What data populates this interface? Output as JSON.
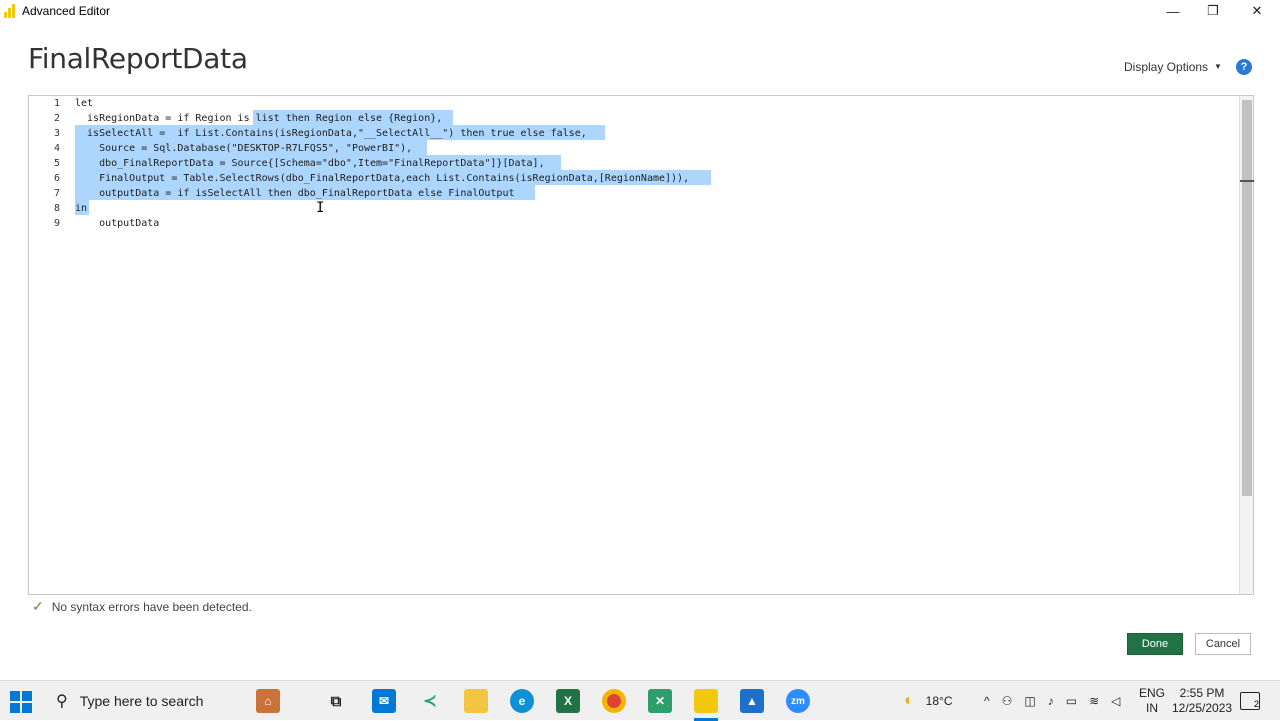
{
  "window": {
    "title": "Advanced Editor",
    "minimize_glyph": "—",
    "restore_glyph": "❐",
    "close_glyph": "✕"
  },
  "editor": {
    "query_name": "FinalReportData",
    "display_options_label": "Display Options",
    "help_glyph": "?",
    "line_numbers": [
      "1",
      "2",
      "3",
      "4",
      "5",
      "6",
      "7",
      "8",
      "9"
    ],
    "status_text": "No syntax errors have been detected.",
    "status_icon": "checkmark-icon",
    "done_label": "Done",
    "cancel_label": "Cancel"
  },
  "code_lines": [
    {
      "text": "let"
    },
    {
      "text": "  isRegionData = if Region is list then Region else {Region},"
    },
    {
      "text": "  isSelectAll =  if List.Contains(isRegionData,\"__SelectAll__\") then true else false,"
    },
    {
      "text": "    Source = Sql.Database(\"DESKTOP-R7LFQS5\", \"PowerBI\"),"
    },
    {
      "text": "    dbo_FinalReportData = Source{[Schema=\"dbo\",Item=\"FinalReportData\"]}[Data],"
    },
    {
      "text": "    FinalOutput = Table.SelectRows(dbo_FinalReportData,each List.Contains(isRegionData,[RegionName])),"
    },
    {
      "text": "    outputData = if isSelectAll then dbo_FinalReportData else FinalOutput"
    },
    {
      "text": "in"
    },
    {
      "text": "    outputData"
    }
  ],
  "taskbar": {
    "search_placeholder": "Type here to search",
    "weather_temp": "18°C",
    "language_line1": "ENG",
    "language_line2": "IN",
    "time": "2:55 PM",
    "date": "12/25/2023",
    "notification_count": "2",
    "apps": [
      "task-view",
      "mail",
      "visual-studio-code",
      "file-explorer",
      "edge",
      "excel",
      "chrome",
      "app-diagram",
      "power-bi",
      "paint",
      "zoom"
    ]
  },
  "colors": {
    "selection": "#add6ff",
    "done_button": "#217346",
    "help": "#2b79d6",
    "powerbi_yellow": "#f2c811"
  }
}
